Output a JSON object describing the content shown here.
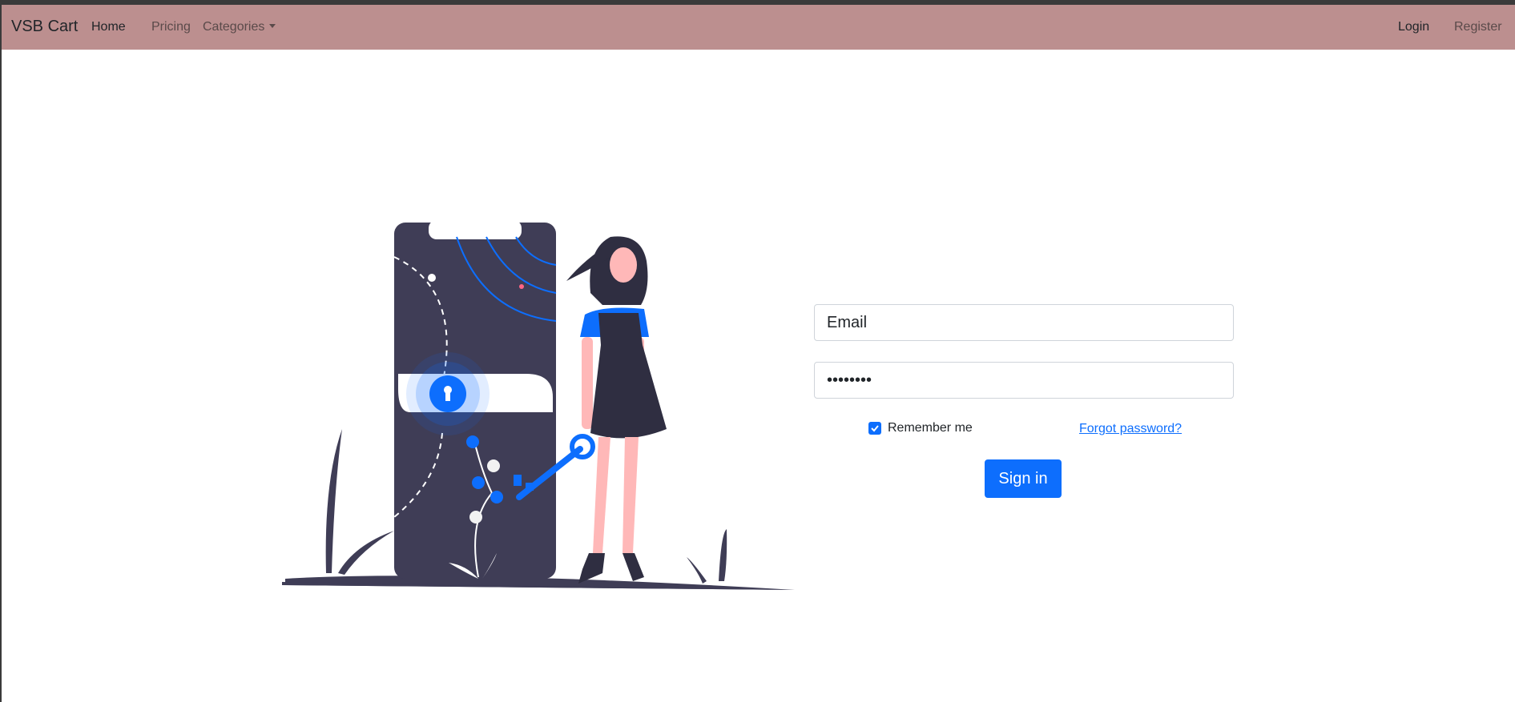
{
  "navbar": {
    "brand": "VSB Cart",
    "home": "Home",
    "pricing": "Pricing",
    "categories": "Categories",
    "login": "Login",
    "register": "Register"
  },
  "form": {
    "email_placeholder": "Email",
    "password_value": "••••••••",
    "remember_label": "Remember me",
    "remember_checked": true,
    "forgot_label": "Forgot password?",
    "signin_label": "Sign in"
  },
  "colors": {
    "navbar_bg": "#bc8f8f",
    "primary": "#0d6efd",
    "illustration_dark": "#3f3d56",
    "skin": "#ffb8b8"
  }
}
